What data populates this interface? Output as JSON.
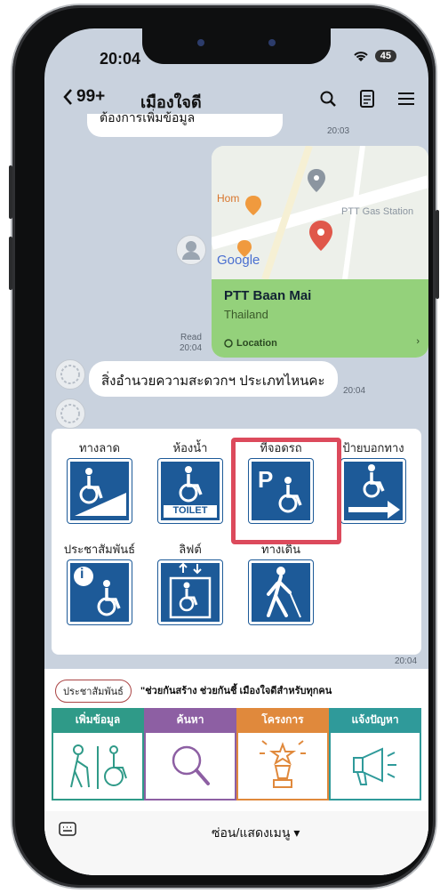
{
  "status_bar": {
    "time": "20:04",
    "battery": "45"
  },
  "header": {
    "back_label": "99+",
    "title": "เมืองใจดี"
  },
  "messages": {
    "top_text": "ต้องการเพิ่มข้อมูล",
    "top_time": "20:03",
    "read_label": "Read",
    "read_time": "20:04",
    "question": "สิ่งอำนวยความสะดวกฯ ประเภทไหนคะ",
    "question_time": "20:04",
    "menu_time": "20:04"
  },
  "location_card": {
    "map_labels": {
      "hom": "Hom",
      "google": "Google",
      "station": "PTT Gas Station"
    },
    "place_name": "PTT Baan Mai",
    "country": "Thailand",
    "location_label": "Location"
  },
  "facility_menu": {
    "items": [
      {
        "label": "ทางลาด",
        "icon": "ramp-icon"
      },
      {
        "label": "ห้องน้ำ",
        "icon": "toilet-icon",
        "sign_text": "TOILET"
      },
      {
        "label": "ที่จอดรถ",
        "icon": "parking-icon",
        "sign_text": "P",
        "highlighted": true
      },
      {
        "label": "ป้ายบอกทาง",
        "icon": "direction-sign-icon"
      },
      {
        "label": "ประชาสัมพันธ์",
        "icon": "info-icon",
        "sign_text": "i"
      },
      {
        "label": "ลิฟต์",
        "icon": "elevator-icon"
      },
      {
        "label": "ทางเดิน",
        "icon": "walkway-icon"
      }
    ]
  },
  "rich_menu": {
    "chip": "ประชาสัมพันธ์",
    "slogan": "\"ช่วยกันสร้าง ช่วยกันชี้ เมืองใจดีสำหรับทุกคน",
    "columns": [
      {
        "label": "เพิ่มข้อมูล",
        "color": "#2f9a88"
      },
      {
        "label": "ค้นหา",
        "color": "#8d5fa3"
      },
      {
        "label": "โครงการ",
        "color": "#e0893c"
      },
      {
        "label": "แจ้งปัญหา",
        "color": "#2f9a9a"
      }
    ],
    "toggle_label": "ซ่อน/แสดงเมนู ▾"
  },
  "colors": {
    "sign_blue": "#1d5a98",
    "highlight": "#dc4a5c",
    "map_green": "#94d17b"
  }
}
